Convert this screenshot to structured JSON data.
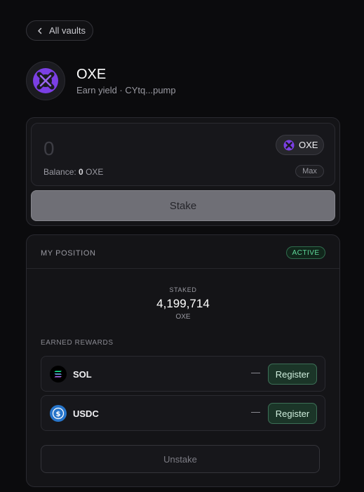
{
  "nav": {
    "back_label": "All vaults",
    "back_icon": "chevron-left-icon"
  },
  "vault": {
    "title": "OXE",
    "subtitle": "Earn yield · CYtq...pump",
    "logo_icon": "oxe-logo-icon",
    "brand_color": "#7b3fe4"
  },
  "stake_form": {
    "amount": "0",
    "token": "OXE",
    "balance_label": "Balance:",
    "balance_value": "0",
    "balance_unit": "OXE",
    "max_label": "Max",
    "stake_label": "Stake"
  },
  "position": {
    "header_label": "MY POSITION",
    "status": "ACTIVE",
    "status_color": "#5fd99a",
    "staked_label": "STAKED",
    "staked_value": "4,199,714",
    "staked_unit": "OXE",
    "rewards_label": "EARNED REWARDS",
    "rewards": [
      {
        "token": "SOL",
        "icon": "solana-icon",
        "amount": "—",
        "action": "Register"
      },
      {
        "token": "USDC",
        "icon": "usdc-icon",
        "amount": "—",
        "action": "Register"
      }
    ],
    "unstake_label": "Unstake"
  }
}
